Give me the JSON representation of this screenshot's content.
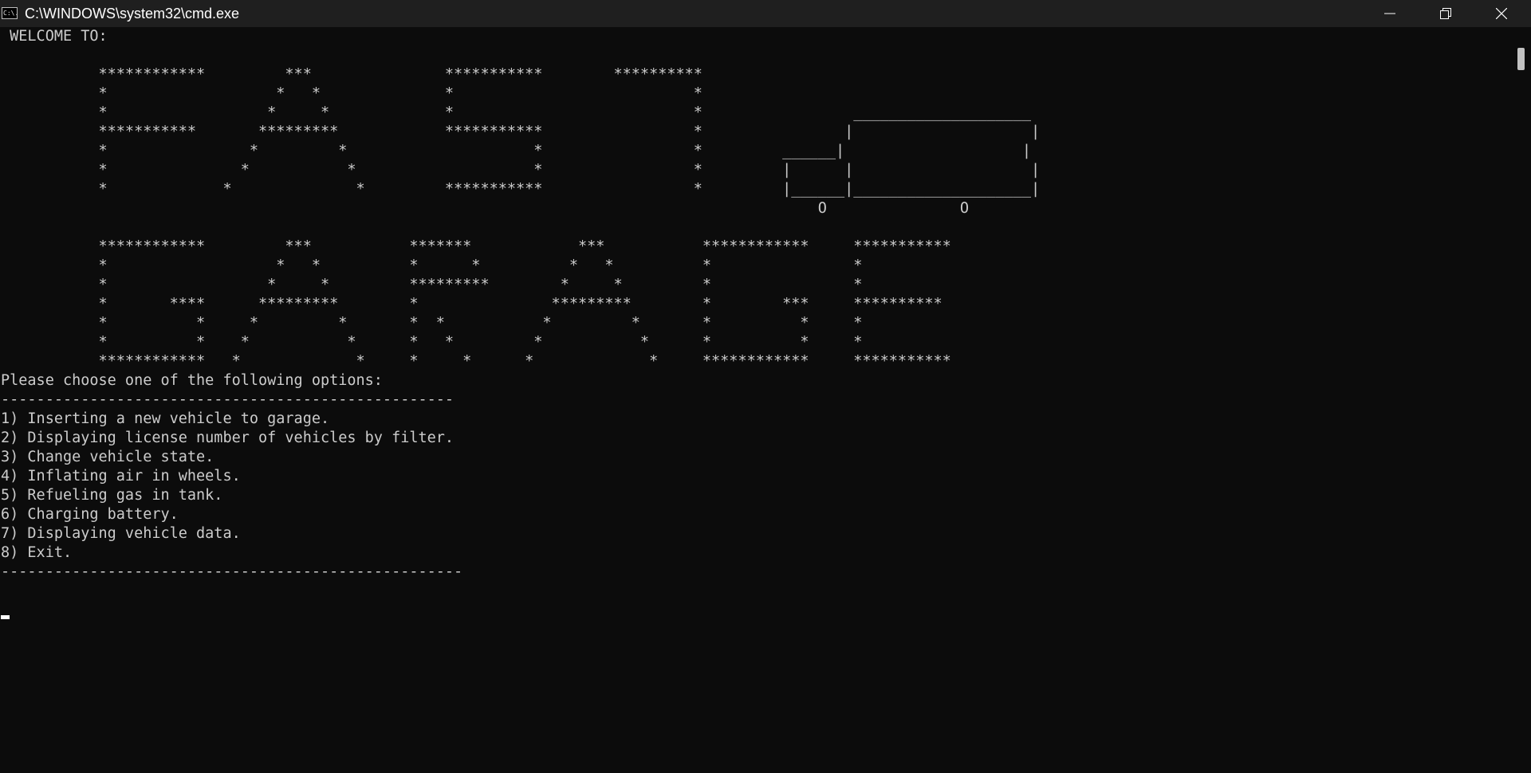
{
  "window": {
    "title": "C:\\WINDOWS\\system32\\cmd.exe",
    "icon_text": "C:\\.",
    "controls": {
      "minimize": "minimize-icon",
      "maximize": "restore-icon",
      "close": "close-icon"
    }
  },
  "console": {
    "welcome": " WELCOME TO:",
    "banner": "\n           ************         ***               ***********        **********\n           *                   *   *              *                           *\n           *                  *     *             *                           *                 ____________________\n           ***********       *********            ***********                 *                |                    |\n           *                *         *                     *                 *         ______|                    |\n           *               *           *                    *                 *         |      |                    |\n           *             *              *         ***********                 *         |______|____________________|\n                                                                                            O               O\n\n           ************         ***           *******            ***           ************     ***********\n           *                   *   *          *      *          *   *          *                *\n           *                  *     *         *********        *     *         *                *\n           *       ****      *********        *               *********        *        ***     **********\n           *          *     *         *       *  *           *         *       *          *     *\n           *          *    *           *      *   *         *           *      *          *     *\n           ************   *             *     *     *      *             *     ************     ***********\n",
    "prompt": "Please choose one of the following options:",
    "separator_top": "---------------------------------------------------",
    "options": [
      "1) Inserting a new vehicle to garage.",
      "2) Displaying license number of vehicles by filter.",
      "3) Change vehicle state.",
      "4) Inflating air in wheels.",
      "5) Refueling gas in tank.",
      "6) Charging battery.",
      "7) Displaying vehicle data.",
      "8) Exit."
    ],
    "separator_bottom": "----------------------------------------------------"
  },
  "colors": {
    "background": "#0c0c0c",
    "titlebar": "#1f1f1f",
    "text": "#cccccc"
  }
}
